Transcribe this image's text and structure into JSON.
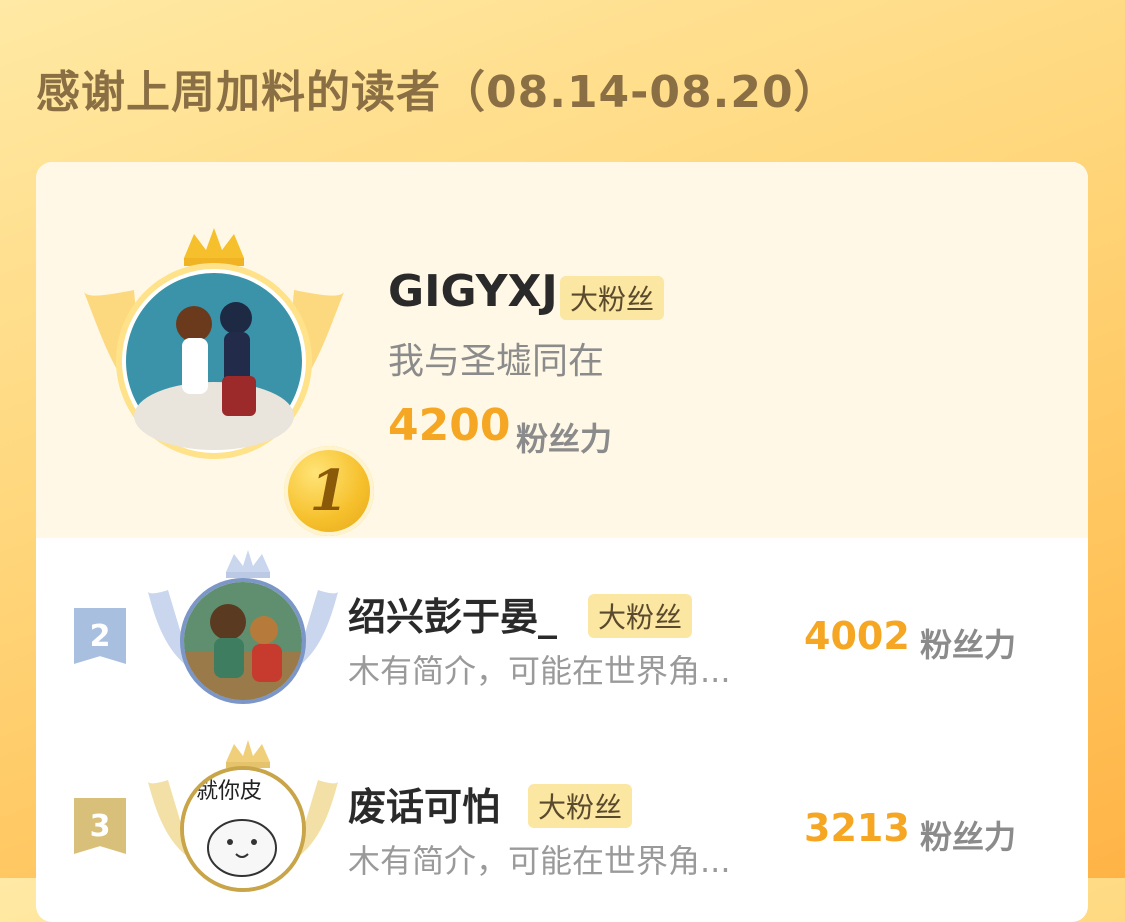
{
  "header": {
    "title": "感谢上周加料的读者（08.14-08.20）"
  },
  "fan_badge_label": "大粉丝",
  "fan_power_unit": "粉丝力",
  "leaderboard": {
    "top": {
      "rank": "1",
      "name": "GIGYXJ",
      "bio": "我与圣墟同在",
      "score": "4200"
    },
    "others": [
      {
        "rank": "2",
        "name": "绍兴彭于晏_",
        "bio": "木有简介，可能在世界角...",
        "score": "4002",
        "rank_color": "#a9bfe0"
      },
      {
        "rank": "3",
        "name": "废话可怕",
        "bio": "木有简介，可能在世界角...",
        "score": "3213",
        "rank_color": "#d9c07a"
      }
    ]
  },
  "avatar_3_text": "就你皮",
  "colors": {
    "accent": "#f5a623",
    "gold": "#f6c02c",
    "silver": "#a9bfe0",
    "bronze": "#d9c07a"
  },
  "icons": [
    "crown-icon",
    "wing-icon",
    "gold-medal-icon",
    "silver-rank-flag-icon",
    "bronze-rank-flag-icon"
  ]
}
